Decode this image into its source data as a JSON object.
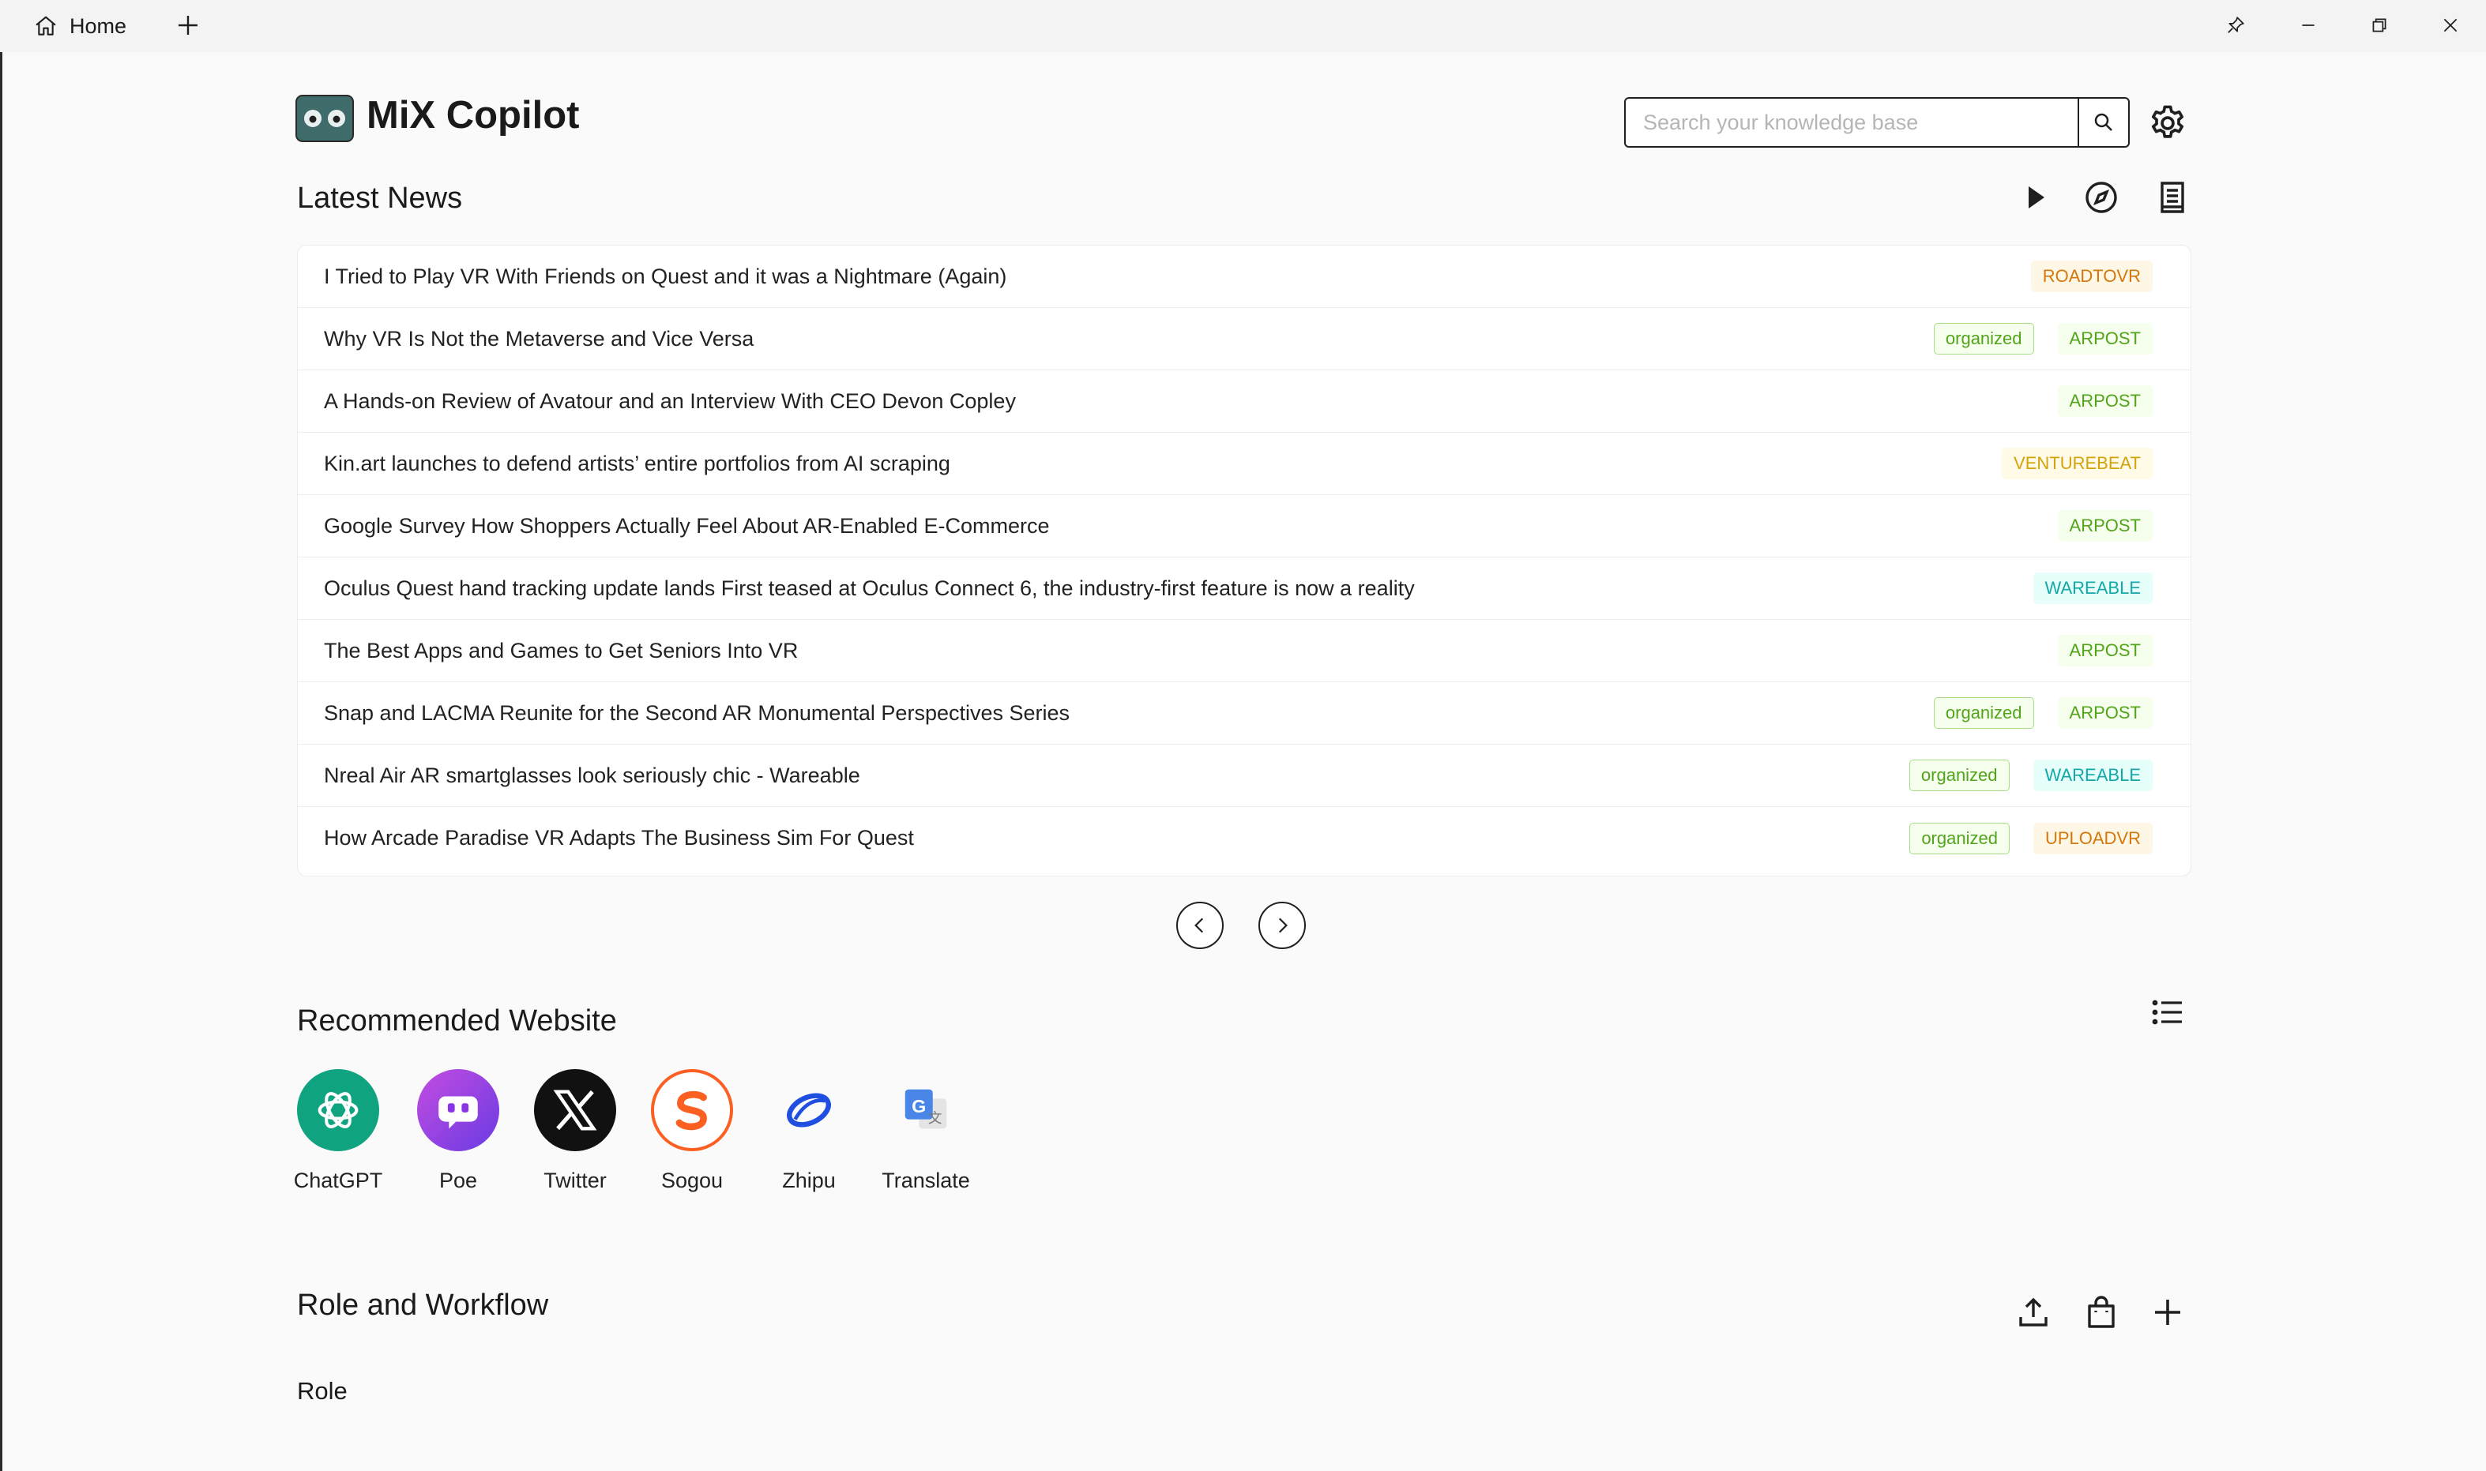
{
  "titlebar": {
    "tab_label": "Home"
  },
  "header": {
    "app_title": "MiX Copilot",
    "search_placeholder": "Search your knowledge base"
  },
  "news": {
    "title": "Latest News",
    "items": [
      {
        "title": "I Tried to Play VR With Friends on Quest and it was a Nightmare (Again)",
        "organized": "",
        "source": "ROADTOVR",
        "source_color": "orange"
      },
      {
        "title": "Why VR Is Not the Metaverse and Vice Versa",
        "organized": "organized",
        "source": "ARPOST",
        "source_color": "green"
      },
      {
        "title": "A Hands-on Review of Avatour and an Interview With CEO Devon Copley",
        "organized": "",
        "source": "ARPOST",
        "source_color": "green"
      },
      {
        "title": "Kin.art launches to defend artists’ entire portfolios from AI scraping",
        "organized": "",
        "source": "VENTUREBEAT",
        "source_color": "gold"
      },
      {
        "title": "Google Survey How Shoppers Actually Feel About AR-Enabled E-Commerce",
        "organized": "",
        "source": "ARPOST",
        "source_color": "green"
      },
      {
        "title": "Oculus Quest hand tracking update lands First teased at Oculus Connect 6, the industry-first feature is now a reality",
        "organized": "",
        "source": "WAREABLE",
        "source_color": "cyan"
      },
      {
        "title": "The Best Apps and Games to Get Seniors Into VR",
        "organized": "",
        "source": "ARPOST",
        "source_color": "green"
      },
      {
        "title": "Snap and LACMA Reunite for the Second AR Monumental Perspectives Series",
        "organized": "organized",
        "source": "ARPOST",
        "source_color": "green"
      },
      {
        "title": "Nreal Air AR smartglasses look seriously chic - Wareable",
        "organized": "organized",
        "source": "WAREABLE",
        "source_color": "cyan"
      },
      {
        "title": "How Arcade Paradise VR Adapts The Business Sim For Quest",
        "organized": "organized",
        "source": "UPLOADVR",
        "source_color": "orange"
      }
    ]
  },
  "websites": {
    "title": "Recommended Website",
    "items": [
      {
        "label": "ChatGPT",
        "icon": "chatgpt-icon"
      },
      {
        "label": "Poe",
        "icon": "poe-icon"
      },
      {
        "label": "Twitter",
        "icon": "x-icon"
      },
      {
        "label": "Sogou",
        "icon": "sogou-icon"
      },
      {
        "label": "Zhipu",
        "icon": "zhipu-icon"
      },
      {
        "label": "Translate",
        "icon": "google-translate-icon"
      }
    ]
  },
  "workflow": {
    "title": "Role and Workflow",
    "role_label": "Role"
  },
  "colors": {
    "background": "#fafafa",
    "organized_green": "#52a41a",
    "chatgpt": "#10a37f",
    "poe": "#8a35e6",
    "sogou": "#fb6022",
    "zhipu": "#1f4fe0"
  }
}
